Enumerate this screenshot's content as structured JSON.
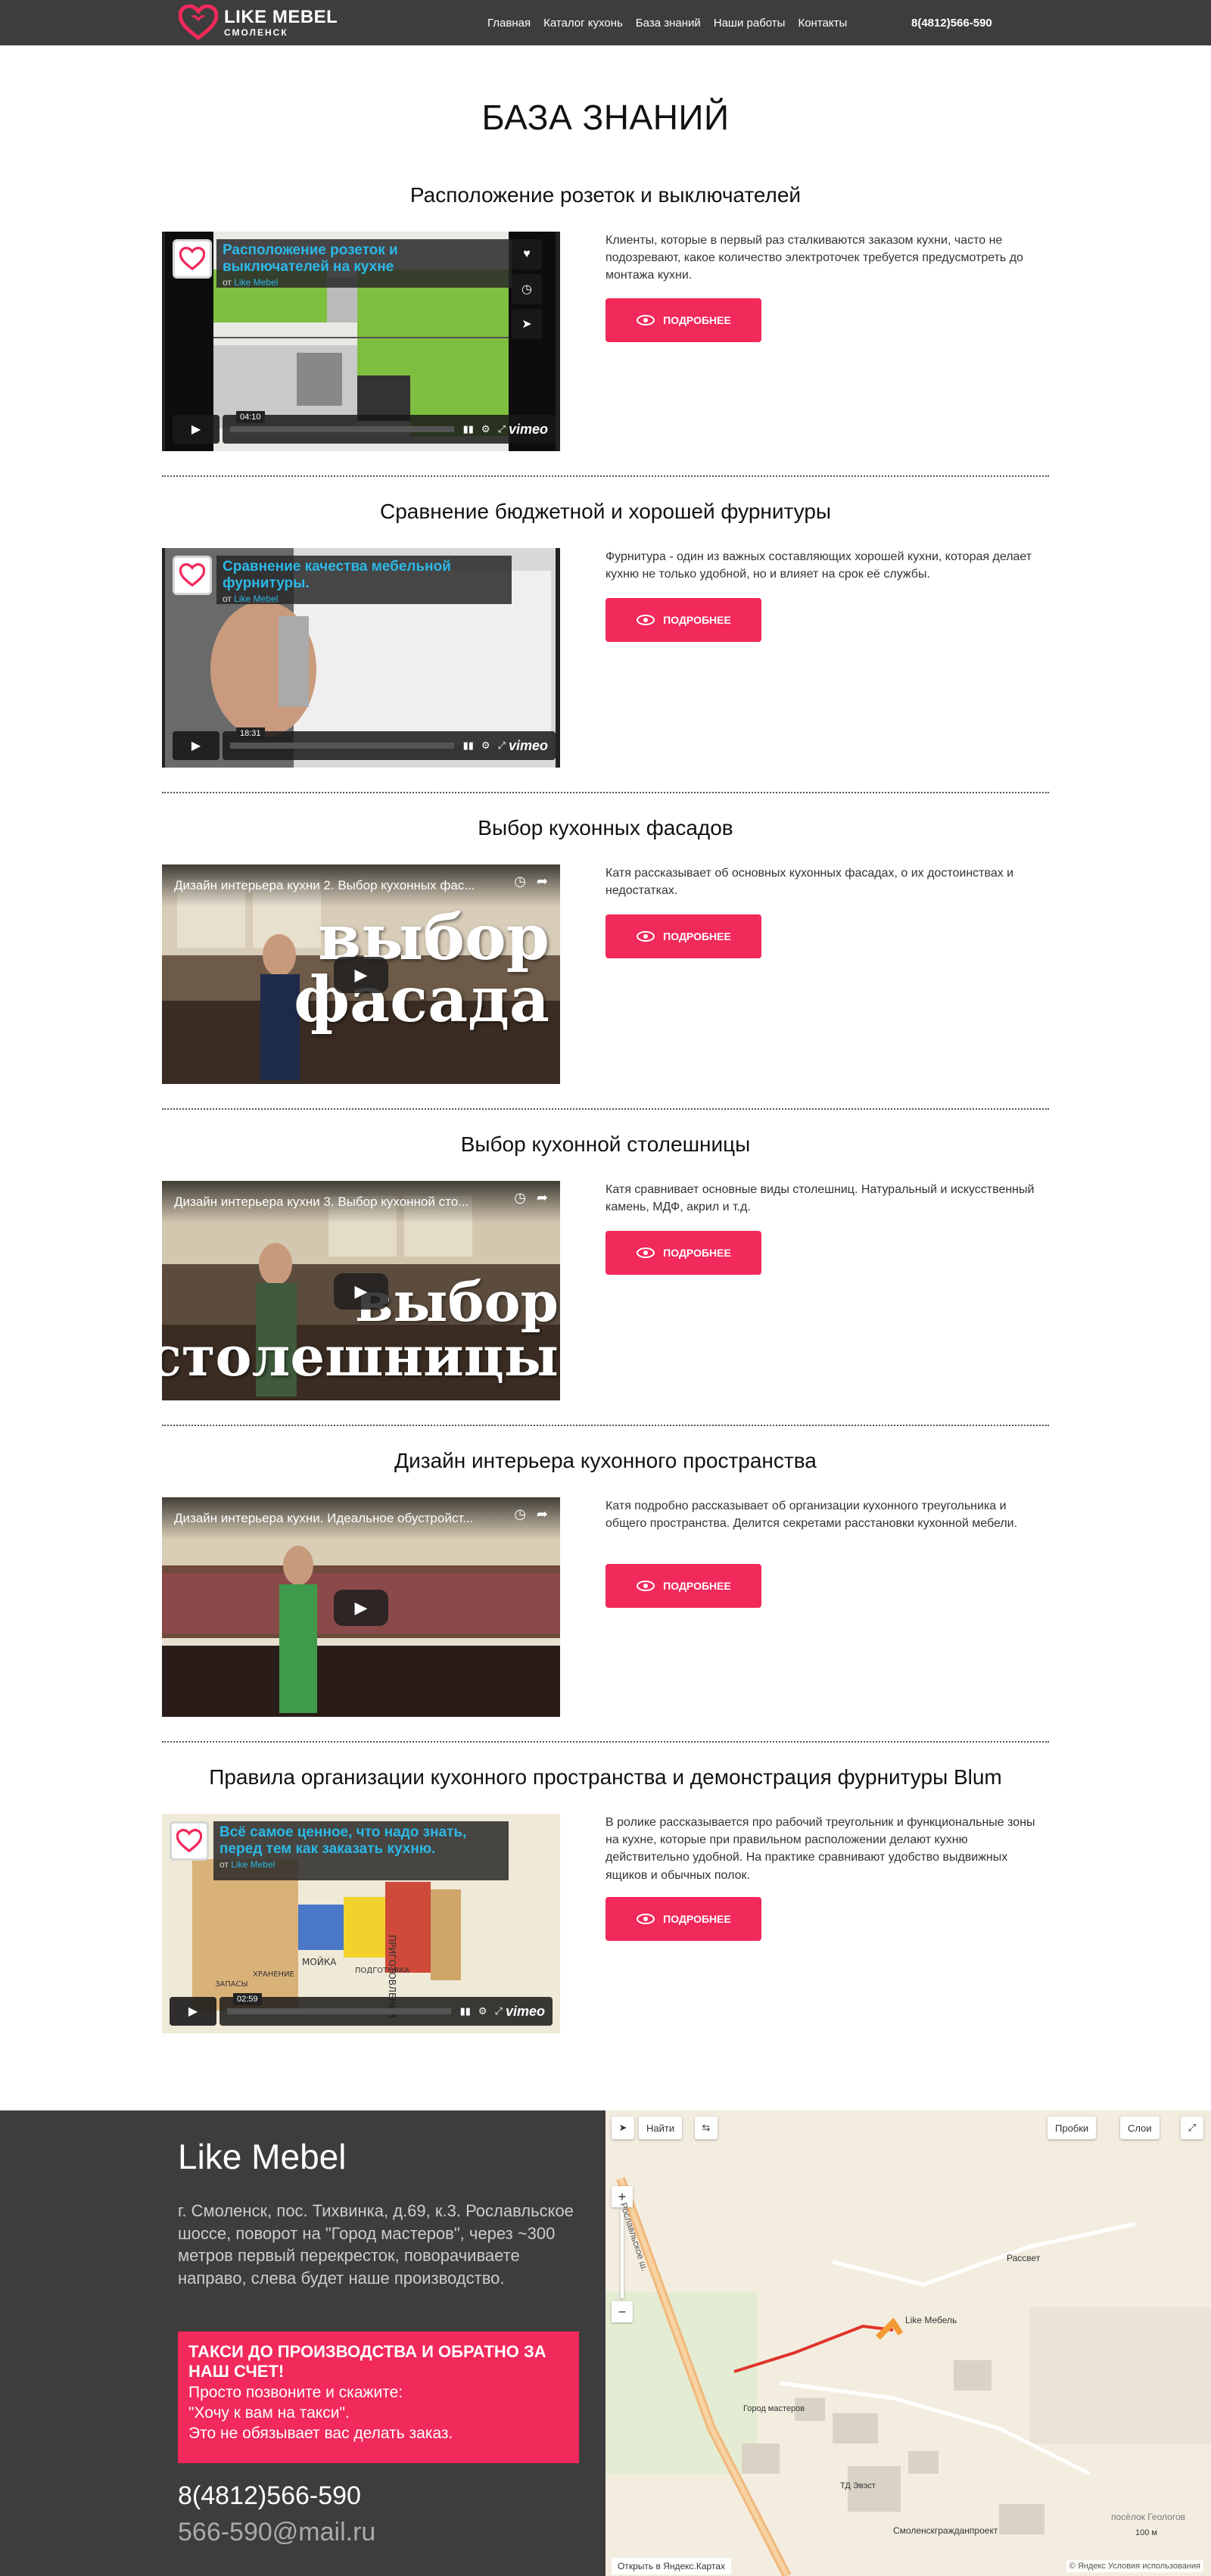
{
  "header": {
    "logo_name": "LIKE MEBEL",
    "logo_city": "СМОЛЕНСК",
    "nav": [
      "Главная",
      "Каталог кухонь",
      "База знаний",
      "Наши работы",
      "Контакты"
    ],
    "phone": "8(4812)566-590"
  },
  "page_title": "БАЗА ЗНАНИЙ",
  "more_label": "ПОДРОБНЕЕ",
  "articles": [
    {
      "title": "Расположение розеток и выключателей",
      "video_title": "Расположение розеток и выключателей на кухне",
      "video_by": "от",
      "video_author": "Like Mebel",
      "video_duration": "04:10",
      "description": "Клиенты, которые в первый раз сталкиваются заказом кухни, часто не подозревают, какое количество электроточек требуется предусмотреть до монтажа кухни."
    },
    {
      "title": "Сравнение бюджетной и хорошей фурнитуры",
      "video_title": "Сравнение качества мебельной фурнитуры.",
      "video_by": "от",
      "video_author": "Like Mebel",
      "video_duration": "18:31",
      "description": "Фурнитура - один из важных составляющих хорошей кухни, которая делает кухню не только удобной, но и влияет на срок её службы."
    },
    {
      "title": "Выбор кухонных фасадов",
      "video_title": "Дизайн интерьера кухни 2. Выбор кухонных фас...",
      "big_text": [
        "выбор",
        "фасада"
      ],
      "description": "Катя рассказывает об основных кухонных фасадах, о их достоинствах и недостатках."
    },
    {
      "title": "Выбор кухонной столешницы",
      "video_title": "Дизайн интерьера кухни 3. Выбор кухонной сто...",
      "big_text": [
        "выбор",
        "столешницы"
      ],
      "description": "Катя сравнивает основные виды столешниц. Натуральный и искусственный камень, МДФ, акрил и т.д."
    },
    {
      "title": "Дизайн интерьера кухонного пространства",
      "video_title": "Дизайн интерьера кухни. Идеальное обустройст...",
      "description": "Катя подробно рассказывает об организации кухонного треугольника и общего пространства. Делится секретами расстановки кухонной мебели."
    },
    {
      "title": "Правила организации кухонного пространства и демонстрация фурнитуры Blum",
      "video_title": "Всё самое ценное, что надо знать, перед тем как заказать кухню.",
      "video_by": "от",
      "video_author": "Like Mebel",
      "video_duration": "02:59",
      "scene_words": [
        "ПРИГОТОВЛЕНИЯ",
        "МОЙКА",
        "ПОДГОТОВКА",
        "ХРАНЕНИЕ",
        "ЗАПАСЫ"
      ],
      "description": "В ролике рассказывается про рабочий треугольник и функциональные зоны на кухне, которые при правильном расположении делают кухню действительно удобной. На практике сравнивают удобство выдвижных ящиков и обычных полок."
    }
  ],
  "footer": {
    "title": "Like Mebel",
    "address": "г. Смоленск, пос. Тихвинка, д.69, к.3. Рославльское шоссе, поворот на \"Город мастеров\", через ~300 метров первый перекресток, поворачиваете направо, слева будет наше производство.",
    "taxi_heading": "ТАКСИ ДО ПРОИЗВОДСТВА И ОБРАТНО ЗА НАШ СЧЕТ!",
    "taxi_lines": [
      "Просто позвоните и скажите:",
      "\"Хочу к вам на такси\".",
      "Это не обязывает вас делать заказ."
    ],
    "phone": "8(4812)566-590",
    "email": "566-590@mail.ru"
  },
  "map": {
    "find": "Найти",
    "traffic": "Пробки",
    "layers": "Слои",
    "place_labels": [
      "Рассвет",
      "Like Мебель",
      "Город мастеров",
      "ТД Эвэст",
      "Смоленскгражданпроект",
      "посёлок Геологов"
    ],
    "road_label": "Рославльское ш.",
    "scale": "100 м",
    "open_label": "Открыть в Яндекс.Картах",
    "copyright": "© Яндекс Условия использования"
  },
  "colors": {
    "accent": "#f2295b",
    "header_bg": "#3d3d3d",
    "vimeo_blue": "#2cb8e6"
  }
}
